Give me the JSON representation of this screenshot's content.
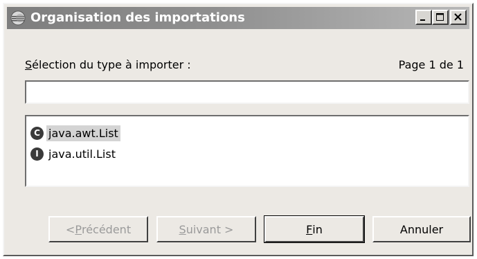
{
  "window": {
    "title": "Organisation des importations",
    "icon": "eclipse-icon"
  },
  "titlebar_buttons": {
    "minimize": "minimize-icon",
    "maximize": "maximize-icon",
    "close": "close-icon"
  },
  "selection": {
    "label_accel": "S",
    "label_rest": "élection du type à importer :",
    "page_label": "Page 1 de 1",
    "search_value": ""
  },
  "list": {
    "items": [
      {
        "badge": "C",
        "text": "java.awt.List",
        "selected": true,
        "icon": "class-icon"
      },
      {
        "badge": "I",
        "text": "java.util.List",
        "selected": false,
        "icon": "interface-icon"
      }
    ]
  },
  "buttons": {
    "prev_prefix": "< ",
    "prev_accel": "P",
    "prev_rest": "récédent",
    "next_accel": "S",
    "next_rest": "uivant >",
    "finish_accel": "F",
    "finish_rest": "in",
    "cancel": "Annuler"
  },
  "colors": {
    "window_bg": "#ece9e4",
    "titlebar_start": "#7e7e7e",
    "titlebar_end": "#b8b8b8",
    "selection_bg": "#d4d4d4",
    "disabled_text": "#9a9a9a"
  }
}
